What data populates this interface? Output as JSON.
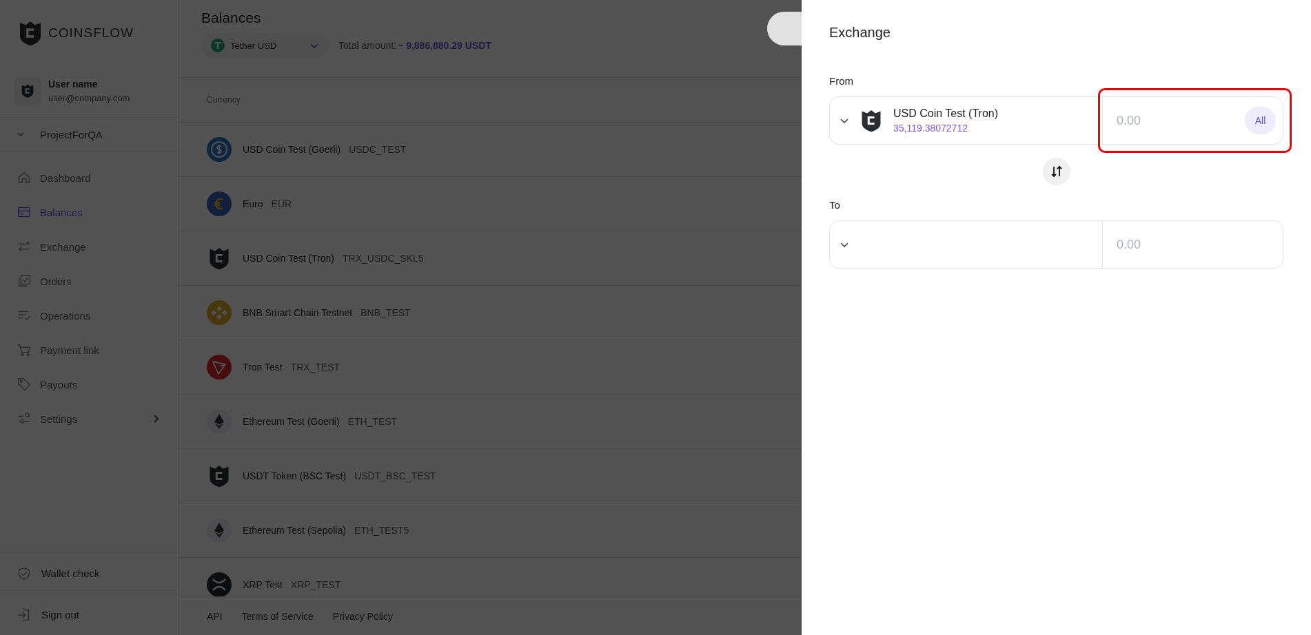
{
  "sidebar": {
    "logo": "COINSFLOW",
    "user": {
      "name": "User name",
      "email": "user@company.com"
    },
    "project": "ProjectForQA",
    "items": [
      {
        "label": "Dashboard",
        "kind": "home",
        "selected": false,
        "has_submenu": false
      },
      {
        "label": "Balances",
        "kind": "card",
        "selected": true,
        "has_submenu": false
      },
      {
        "label": "Exchange",
        "kind": "arrows",
        "selected": false,
        "has_submenu": false
      },
      {
        "label": "Orders",
        "kind": "orders",
        "selected": false,
        "has_submenu": false
      },
      {
        "label": "Operations",
        "kind": "list",
        "selected": false,
        "has_submenu": false
      },
      {
        "label": "Payment link",
        "kind": "cart",
        "selected": false,
        "has_submenu": false
      },
      {
        "label": "Payouts",
        "kind": "tag",
        "selected": false,
        "has_submenu": false
      },
      {
        "label": "Settings",
        "kind": "sliders",
        "selected": false,
        "has_submenu": true
      }
    ],
    "bottom_items": [
      {
        "label": "Wallet check",
        "kind": "shield"
      },
      {
        "label": "Sign out",
        "kind": "signout"
      }
    ]
  },
  "main": {
    "title": "Balances",
    "currency_select": "Tether USD",
    "total_label": "Total amount:",
    "total_value": "~ 9,886,880.29 USDT",
    "table": {
      "columns": [
        "Currency"
      ],
      "rows": [
        {
          "name": "USD Coin Test (Goerli)",
          "code": "USDC_TEST",
          "kind": "usdc"
        },
        {
          "name": "Euro",
          "code": "EUR",
          "kind": "euro"
        },
        {
          "name": "USD Coin Test (Tron)",
          "code": "TRX_USDC_SKL5",
          "kind": "shield"
        },
        {
          "name": "BNB Smart Chain Testnet",
          "code": "BNB_TEST",
          "kind": "bnb"
        },
        {
          "name": "Tron Test",
          "code": "TRX_TEST",
          "kind": "tron"
        },
        {
          "name": "Ethereum Test (Goerli)",
          "code": "ETH_TEST",
          "kind": "eth"
        },
        {
          "name": "USDT Token (BSC Test)",
          "code": "USDT_BSC_TEST",
          "kind": "shield"
        },
        {
          "name": "Ethereum Test (Sepolia)",
          "code": "ETH_TEST5",
          "kind": "eth"
        },
        {
          "name": "XRP Test",
          "code": "XRP_TEST",
          "kind": "xrp"
        }
      ]
    },
    "footer": [
      "API",
      "Terms of Service",
      "Privacy Policy"
    ]
  },
  "exchange_panel": {
    "title": "Exchange",
    "from": {
      "label": "From",
      "currency": "USD Coin Test (Tron)",
      "balance": "35,119.38072712",
      "amount_placeholder": "0.00",
      "all_button": "All",
      "highlighted": true
    },
    "to": {
      "label": "To",
      "amount_placeholder": "0.00"
    }
  }
}
